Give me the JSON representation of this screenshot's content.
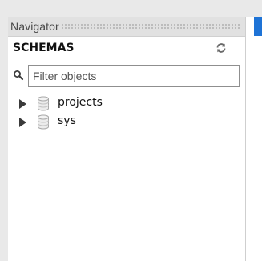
{
  "navigator": {
    "title": "Navigator",
    "section_title": "SCHEMAS",
    "refresh_icon": "refresh-icon",
    "filter": {
      "placeholder": "Filter objects",
      "value": ""
    },
    "schemas": [
      {
        "name": "projects",
        "icon": "database-icon",
        "expanded": false
      },
      {
        "name": "sys",
        "icon": "database-icon",
        "expanded": false
      }
    ]
  },
  "colors": {
    "background": "#e9e9e9",
    "panel": "#ffffff",
    "header": "#e1e1e1",
    "accent": "#1e73d6"
  }
}
